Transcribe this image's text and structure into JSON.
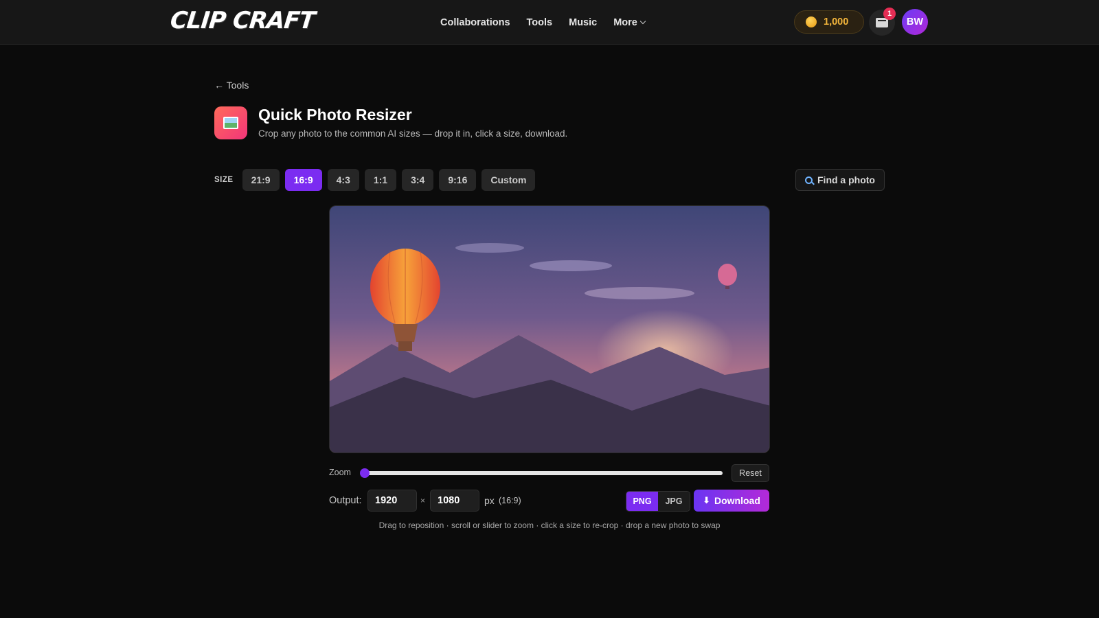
{
  "header": {
    "logo_text": "CLIP CRAFT",
    "nav": [
      "Collaborations",
      "Tools",
      "Music",
      "More"
    ],
    "coins": "1,000",
    "notification_count": "1",
    "avatar_initials": "BW"
  },
  "page": {
    "back_label": "← Tools",
    "title": "Quick Photo Resizer",
    "subtitle": "Crop any photo to the common AI sizes — drop it in, click a size, download."
  },
  "size": {
    "label": "SIZE",
    "options": [
      "21:9",
      "16:9",
      "4:3",
      "1:1",
      "3:4",
      "9:16",
      "Custom"
    ],
    "selected": "16:9",
    "find_label": "Find a photo"
  },
  "zoom": {
    "label": "Zoom",
    "value": 0.0,
    "reset_label": "Reset"
  },
  "output": {
    "label": "Output:",
    "width": "1920",
    "times": "×",
    "height": "1080",
    "unit": "px",
    "ratio": "(16:9)",
    "formats": [
      "PNG",
      "JPG"
    ],
    "selected_format": "PNG",
    "download_label": "Download"
  },
  "hint": "Drag to reposition · scroll or slider to zoom · click a size to re-crop · drop a new photo to swap",
  "colors": {
    "accent": "#7b2cf1",
    "coin": "#f3b53b",
    "badge": "#e52d54"
  },
  "icons": {
    "coin": "coin-icon",
    "inbox": "inbox-icon",
    "tool": "image-icon",
    "find": "search-icon",
    "download": "download-icon"
  }
}
